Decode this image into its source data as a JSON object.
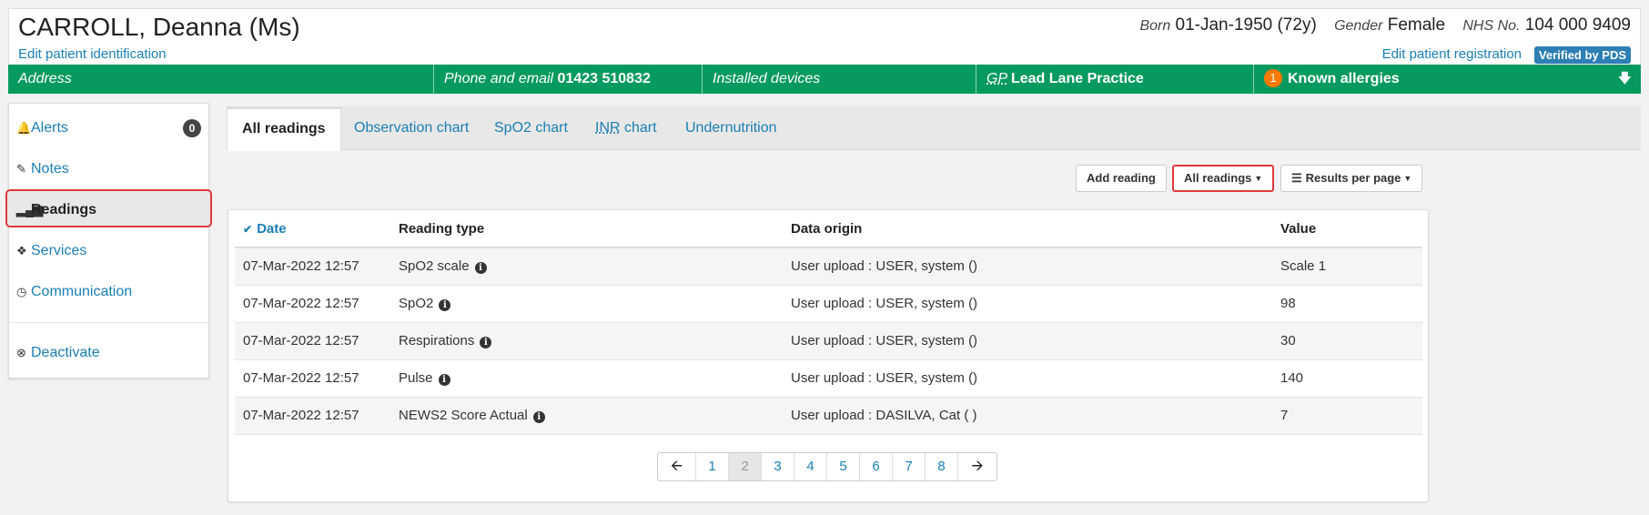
{
  "patient": {
    "name": "CARROLL, Deanna (Ms)",
    "edit_identification": "Edit patient identification",
    "born_label": "Born",
    "born_value": "01-Jan-1950 (72y)",
    "gender_label": "Gender",
    "gender_value": "Female",
    "nhs_label": "NHS No.",
    "nhs_value": "104 000 9409",
    "edit_registration": "Edit patient registration",
    "verified_badge": "Verified by PDS"
  },
  "banner": {
    "address_label": "Address",
    "phone_label": "Phone and email",
    "phone_value": "01423 510832",
    "devices_label": "Installed devices",
    "gp_label": "GP",
    "gp_value": "Lead Lane Practice",
    "allergy_count": "1",
    "allergy_label": "Known allergies",
    "color": "#069a5f"
  },
  "sidebar": {
    "items": [
      {
        "label": "Alerts",
        "icon": "bell-icon",
        "count": "0"
      },
      {
        "label": "Notes",
        "icon": "edit-icon"
      },
      {
        "label": "Readings",
        "icon": "signal-icon",
        "active": true
      },
      {
        "label": "Services",
        "icon": "tags-icon"
      },
      {
        "label": "Communication",
        "icon": "clock-icon"
      },
      {
        "label": "Deactivate",
        "icon": "circle-x-icon"
      }
    ]
  },
  "tabs": [
    {
      "label": "All readings",
      "active": true
    },
    {
      "label": "Observation chart"
    },
    {
      "label": "SpO2 chart"
    },
    {
      "label": "INR",
      "suffix": " chart"
    },
    {
      "label": "Undernutrition"
    }
  ],
  "actions": {
    "add_reading": "Add reading",
    "filter": "All readings",
    "results_per_page": "Results per page"
  },
  "table": {
    "columns": [
      "Date",
      "Reading type",
      "Data origin",
      "Value"
    ],
    "rows": [
      {
        "date": "07-Mar-2022 12:57",
        "type": "SpO2 scale",
        "origin": "User upload : USER, system ()",
        "value": "Scale 1"
      },
      {
        "date": "07-Mar-2022 12:57",
        "type": "SpO2",
        "origin": "User upload : USER, system ()",
        "value": "98"
      },
      {
        "date": "07-Mar-2022 12:57",
        "type": "Respirations",
        "origin": "User upload : USER, system ()",
        "value": "30"
      },
      {
        "date": "07-Mar-2022 12:57",
        "type": "Pulse",
        "origin": "User upload : USER, system ()",
        "value": "140"
      },
      {
        "date": "07-Mar-2022 12:57",
        "type": "NEWS2 Score Actual",
        "origin": "User upload : DASILVA, Cat ( )",
        "value": "7"
      }
    ]
  },
  "pagination": {
    "pages": [
      "1",
      "2",
      "3",
      "4",
      "5",
      "6",
      "7",
      "8"
    ],
    "current": "2"
  }
}
